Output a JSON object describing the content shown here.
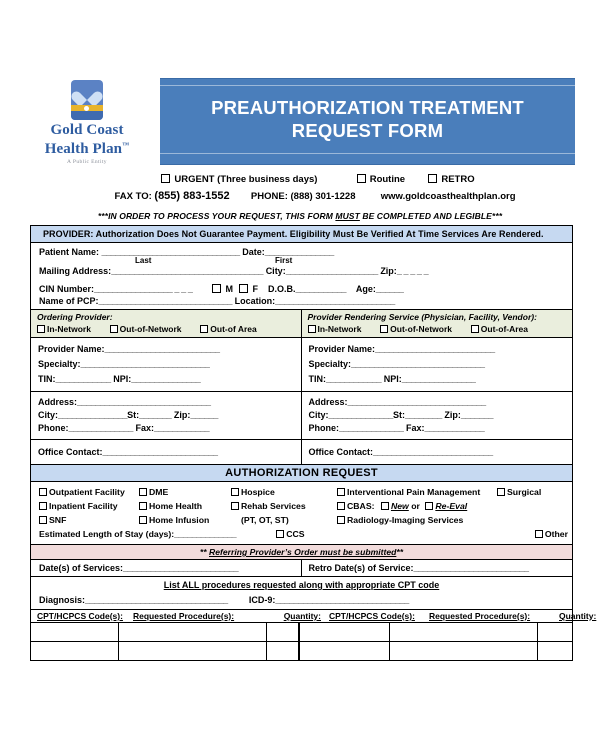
{
  "logo": {
    "name_line1": "Gold Coast",
    "name_line2": "Health Plan",
    "trademark": "™",
    "tagline": "A Public Entity",
    "icon": "heart-wave-logo"
  },
  "header": {
    "title_line1": "PREAUTHORIZATION TREATMENT",
    "title_line2": "REQUEST FORM",
    "band_color": "#4a7ebb"
  },
  "priority": {
    "urgent_label": "URGENT (Three business days)",
    "routine_label": "Routine",
    "retro_label": "RETRO"
  },
  "contact": {
    "fax_label": "FAX TO:",
    "fax_number": "(855) 883-1552",
    "phone_label": "PHONE:",
    "phone_number": "(888) 301-1228",
    "website": "www.goldcoasthealthplan.org"
  },
  "notices": {
    "must_prefix": "***IN ORDER TO PROCESS YOUR REQUEST, THIS FORM ",
    "must_word": "MUST",
    "must_suffix": " BE COMPLETED AND LEGIBLE***",
    "provider_band": "PROVIDER: Authorization Does Not Guarantee Payment. Eligibility Must Be Verified At Time Services Are Rendered.",
    "provider_band_color": "#c6d9f1",
    "referring_prefix": "** ",
    "referring_underlined": "Referring Provider’s Order must be submitted",
    "referring_suffix": "**",
    "referring_band_color": "#f2dcdc"
  },
  "patient": {
    "name_label": "Patient Name:",
    "name_rule": "______________________________",
    "date_label": "Date:",
    "date_rule": "_______________",
    "sub_last": "Last",
    "sub_first": "First",
    "mailing_label": "Mailing Address:",
    "mailing_rule": "_________________________________",
    "city_label": "City:",
    "city_rule": "____________________",
    "zip_label": "Zip:",
    "zip_rule": "_ _ _ _ _",
    "cin_label": "CIN Number:",
    "cin_rule": "_________________ _ _ _",
    "sex_m": "M",
    "sex_f": "F",
    "dob_label": "D.O.B.",
    "dob_rule": "___________",
    "age_label": "Age:",
    "age_rule": "______",
    "pcp_label": "Name of  PCP:",
    "pcp_rule": "_____________________________",
    "location_label": "Location:",
    "location_rule": "__________________________"
  },
  "ordering_provider": {
    "heading": "Ordering Provider:",
    "in_network": "In-Network",
    "out_of_network": "Out-of-Network",
    "out_of_area": "Out-of Area",
    "provider_name_label": "Provider Name:",
    "provider_name_rule": "_________________________",
    "specialty_label": "Specialty:",
    "specialty_rule": "____________________________",
    "tin_label": "TIN:",
    "tin_rule": "____________",
    "npi_label": "NPI:",
    "npi_rule": "_______________",
    "address_label": "Address:",
    "address_rule": "_____________________________",
    "city_label": "City:",
    "city_rule": "_______________",
    "st_label": "St:",
    "st_rule": "_______",
    "zip_label": "Zip:",
    "zip_rule": "______",
    "phone_label": "Phone:",
    "phone_rule": "______________",
    "fax_label": "Fax:",
    "fax_rule": "____________",
    "office_contact_label": "Office Contact:",
    "office_contact_rule": "_________________________"
  },
  "rendering_provider": {
    "heading": "Provider Rendering Service (Physician, Facility, Vendor):",
    "in_network": "In-Network",
    "out_of_network": "Out-of-Network",
    "out_of_area": "Out-of-Area",
    "provider_name_label": "Provider Name:",
    "provider_name_rule": "__________________________",
    "specialty_label": "Specialty:",
    "specialty_rule": "_____________________________",
    "tin_label": "TIN:",
    "tin_rule": "____________",
    "npi_label": "NPI:",
    "npi_rule": "________________",
    "address_label": "Address:",
    "address_rule": "______________________________",
    "city_label": "City:",
    "city_rule": "______________",
    "st_label": "St:",
    "st_rule": "________",
    "zip_label": "Zip:",
    "zip_rule": "_______",
    "phone_label": "Phone:",
    "phone_rule": "______________",
    "fax_label": "Fax:",
    "fax_rule": "_____________",
    "office_contact_label": "Office Contact:",
    "office_contact_rule": "__________________________"
  },
  "authorization": {
    "band_title": "AUTHORIZATION REQUEST",
    "band_color": "#c6d9f1",
    "options": {
      "outpatient_facility": "Outpatient Facility",
      "inpatient_facility": "Inpatient Facility",
      "snf": "SNF",
      "dme": "DME",
      "home_health": "Home Health",
      "home_infusion": "Home Infusion",
      "hospice": "Hospice",
      "rehab_services": "Rehab Services",
      "rehab_note": "(PT, OT, ST)",
      "interventional_pain": "Interventional Pain Management",
      "cbas_label": "CBAS:",
      "cbas_new": "New",
      "cbas_or": "or",
      "cbas_reeval": "Re-Eval",
      "radiology": "Radiology-Imaging Services",
      "ccs": "CCS",
      "surgical": "Surgical",
      "other": "Other"
    },
    "length_of_stay_label": "Estimated Length of Stay (days):",
    "length_of_stay_rule": "______________"
  },
  "services": {
    "dates_label": "Date(s) of Services:",
    "dates_rule": "_________________________",
    "retro_label": "Retro Date(s) of Service:",
    "retro_rule": "_________________________",
    "list_all_note": "List ALL procedures requested along with appropriate CPT code",
    "diagnosis_label": "Diagnosis:",
    "diagnosis_rule": "_______________________________",
    "icd_label": "ICD-9:",
    "icd_rule": "_____________________________"
  },
  "cpt_table": {
    "headers_left": {
      "code": "CPT/HCPCS Code(s):",
      "procedure": "Requested Procedure(s):",
      "quantity": "Quantity:"
    },
    "headers_right": {
      "code": "CPT/HCPCS Code(s):",
      "procedure": "Requested Procedure(s):",
      "quantity": "Quantity:"
    },
    "rows": [
      {
        "left_code": "",
        "left_procedure": "",
        "left_quantity": "",
        "right_code": "",
        "right_procedure": "",
        "right_quantity": ""
      },
      {
        "left_code": "",
        "left_procedure": "",
        "left_quantity": "",
        "right_code": "",
        "right_procedure": "",
        "right_quantity": ""
      }
    ]
  }
}
